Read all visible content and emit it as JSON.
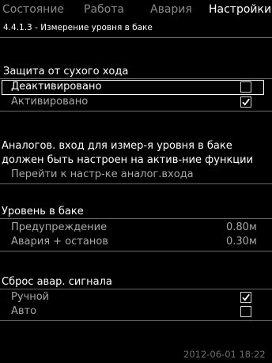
{
  "tabs": [
    {
      "label": "Состояние",
      "active": false
    },
    {
      "label": "Работа",
      "active": false
    },
    {
      "label": "Авария",
      "active": false
    },
    {
      "label": "Настройки",
      "active": true
    }
  ],
  "breadcrumb": "4.4.1.3 - Измерение уровня в баке",
  "dry_run": {
    "heading": "Защита от сухого хода",
    "options": [
      {
        "label": "Деактивировано",
        "checked": false,
        "selected": true
      },
      {
        "label": "Активировано",
        "checked": true,
        "selected": false
      }
    ]
  },
  "analog_note": {
    "line1": "Аналогов. вход для измер-я уровня в баке",
    "line2": "должен быть настроен на актив-ние функции",
    "link": "Перейти к настр-ке аналог.входа"
  },
  "tank_level": {
    "heading": "Уровень в баке",
    "rows": [
      {
        "label": "Предупреждение",
        "value": "0.80м"
      },
      {
        "label": "Авария + останов",
        "value": "0.30м"
      }
    ]
  },
  "alarm_reset": {
    "heading": "Сброс авар. сигнала",
    "options": [
      {
        "label": "Ручной",
        "checked": true
      },
      {
        "label": "Авто",
        "checked": false
      }
    ]
  },
  "timestamp": "2012-06-01 18:22"
}
